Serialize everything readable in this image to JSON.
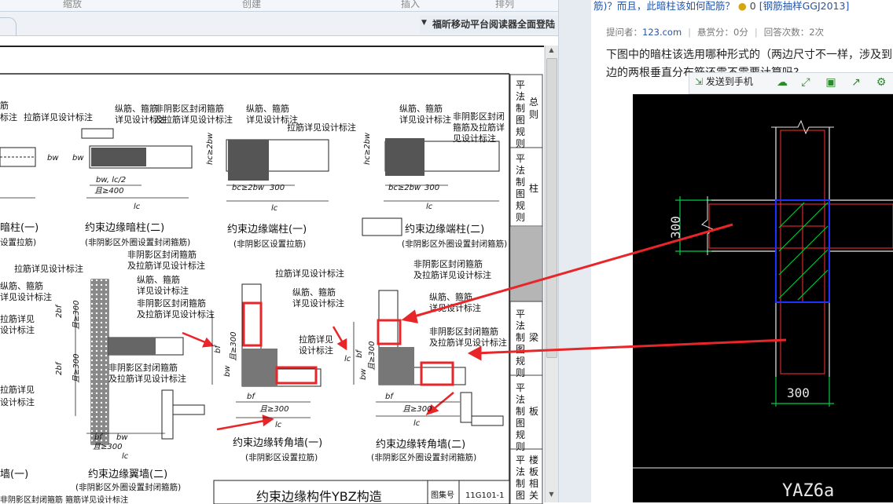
{
  "reader": {
    "ribbon": {
      "items": [
        "缩放",
        "创建",
        "插入",
        "排列"
      ]
    },
    "ad_text": "福昕移动平台阅读器全面登陆",
    "document": {
      "side_tabs": [
        {
          "label": "平法制图规则",
          "right": "总则"
        },
        {
          "label": "平法制图规则",
          "right": "柱"
        },
        {
          "label": "平法制图规则",
          "right": "梁"
        },
        {
          "label": "平法制图规则",
          "right": "板"
        },
        {
          "label": "平法制图规则",
          "right": "楼板相关构造"
        }
      ],
      "top_row": {
        "labels": [
          "拉筋详见设计标注",
          "纵筋、箍筋",
          "详见设计标注",
          "非阴影区封闭箍筋",
          "及拉筋详见设计标注",
          "纵筋、箍筋",
          "详见设计标注",
          "拉筋详见设计标注",
          "纵筋、箍筋",
          "详见设计标注",
          "非阴影区封闭",
          "箍筋及拉筋详",
          "见设计标注"
        ],
        "dims": [
          "bw",
          "bw",
          "hc≥2bw",
          "hc≥2bw",
          "bw, lc/2",
          "且≥400",
          "bc≥2bw",
          "300",
          "bc≥2bw",
          "300",
          "lc",
          "lc",
          "lc"
        ],
        "titles": [
          "暗柱(一)",
          "约束边缘暗柱(二)",
          "约束边缘端柱(一)",
          "约束边缘端柱(二)"
        ],
        "subtitles": [
          "设置拉筋)",
          "(非阴影区外圈设置封闭箍筋)",
          "(非阴影区设置拉筋)",
          "(非阴影区外圈设置封闭箍筋)"
        ]
      },
      "bottom_row": {
        "labels": [
          "拉筋详见设计标注",
          "纵筋、箍筋",
          "详见设计标注",
          "拉筋详见",
          "设计标注",
          "非阴影区封闭箍筋",
          "及拉筋详见设计标注",
          "纵筋、箍筋",
          "详见设计标注",
          "非阴影区封闭箍筋",
          "及拉筋详见设计标注",
          "非阴影区封闭箍筋",
          "及拉筋详见设计标注",
          "拉筋详见设计标注",
          "纵筋、箍筋",
          "详见设计标注",
          "拉筋详见",
          "设计标注",
          "非阴影区封闭箍筋",
          "及拉筋详见设计标注",
          "纵筋、箍筋",
          "详见设计标注",
          "非阴影区封闭箍筋",
          "及拉筋详见设计标注",
          "拉筋详见",
          "设计标注"
        ],
        "dims": [
          "2bf",
          "且≥300",
          "2bf",
          "且≥300",
          "bf",
          "bw",
          "且≥300",
          "lc",
          "bf",
          "且≥300",
          "bw",
          "bf",
          "且≥300",
          "lc",
          "bf",
          "且≥300",
          "bw",
          "bf",
          "且≥300",
          "lc",
          "lc"
        ],
        "titles": [
          "墙(一)",
          "约束边缘翼墙(二)",
          "约束边缘转角墙(一)",
          "约束边缘转角墙(二)"
        ],
        "subtitles": [
          "(非阴影区外圈设置封闭箍筋)",
          "(非阴影区设置拉筋)",
          "(非阴影区外圈设置封闭箍筋)"
        ]
      },
      "footer": {
        "title": "约束边缘构件YBZ构造",
        "atlas_label": "图集号",
        "atlas_value": "11G101-1",
        "bottom_left": "非阴影区封闭箍筋 箍筋详见设计标注"
      }
    }
  },
  "web": {
    "question_title": {
      "prefix": "筋)？而且，此暗柱该如何配筋？",
      "reward": "0",
      "tag": "[钢筋抽样GGJ2013]"
    },
    "meta": {
      "asker_label": "提问者：",
      "asker": "123.com",
      "reward_label": "悬赏分：0分",
      "answers_label": "回答次数：2次"
    },
    "body_line1": "下图中的暗柱该选用哪种形式的（两边尺寸不一样，涉及到",
    "body_line2": "边的两根垂直分布筋还需不需要计算吗?",
    "sharebar": {
      "send_label": "发送到手机",
      "icons": [
        "send-phone-icon",
        "cloud-icon",
        "expand-icon",
        "save-icon",
        "share-icon",
        "settings-icon"
      ]
    },
    "cad": {
      "dim_left": "300",
      "dim_bottom": "300",
      "label": "YAZ6a"
    }
  },
  "colors": {
    "annotation_red": "#e8262a",
    "cad_green": "#00cc44",
    "cad_red": "#ff3030",
    "cad_blue": "#2030ff",
    "link_blue": "#2255aa"
  }
}
